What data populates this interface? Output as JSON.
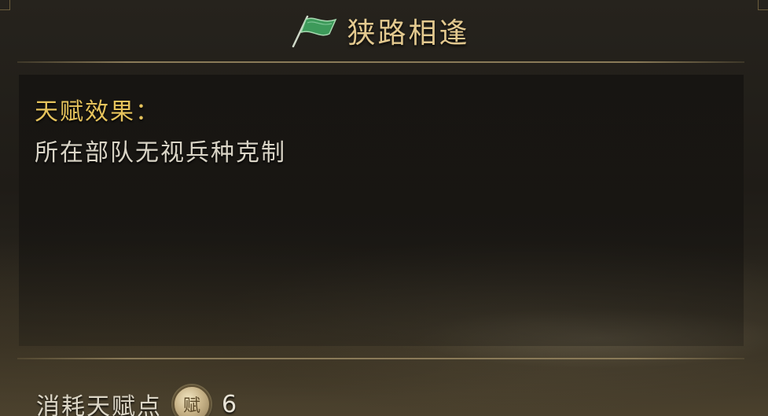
{
  "header": {
    "title": "狭路相逢",
    "icon": "green-flag-icon"
  },
  "content": {
    "effect_label": "天赋效果：",
    "effect_description": "所在部队无视兵种克制"
  },
  "cost": {
    "label": "消耗天赋点",
    "icon": "talent-coin-icon",
    "icon_glyph": "赋",
    "value": "6"
  },
  "colors": {
    "title": "#e3c98f",
    "effect_label": "#e6c35c",
    "text": "#d9d4c6",
    "flag_green": "#3d9a5a",
    "divider": "#8a7a58"
  }
}
